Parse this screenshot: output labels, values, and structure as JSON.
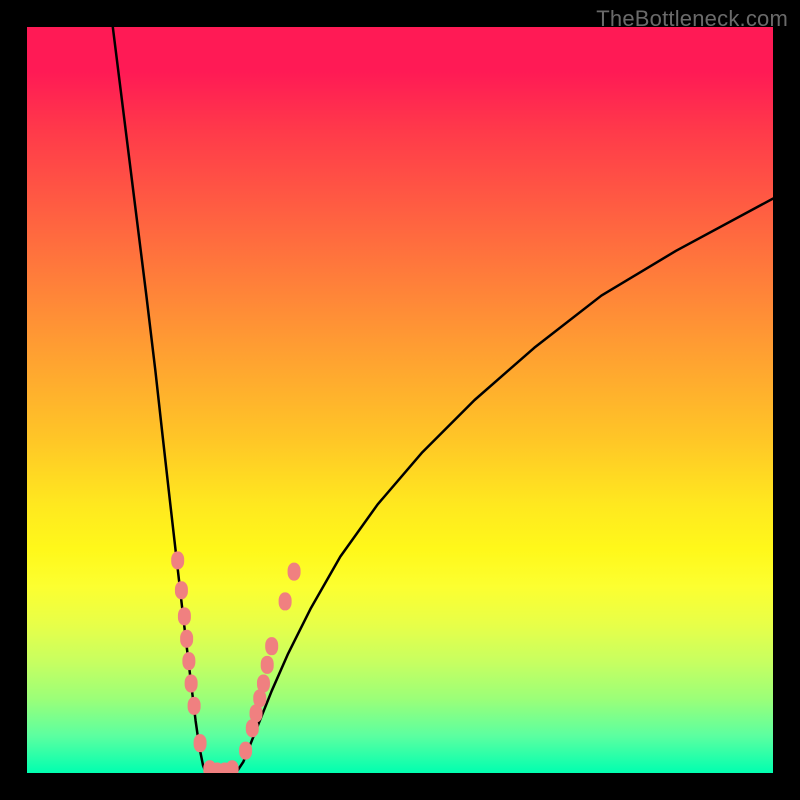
{
  "watermark": "TheBottleneck.com",
  "chart_data": {
    "type": "line",
    "title": "",
    "xlabel": "",
    "ylabel": "",
    "xlim": [
      0,
      100
    ],
    "ylim": [
      0,
      100
    ],
    "grid": false,
    "legend": false,
    "series": [
      {
        "name": "left-curve",
        "x": [
          11.5,
          13.0,
          14.5,
          16.0,
          17.2,
          18.2,
          19.1,
          19.9,
          20.7,
          21.4,
          22.0,
          22.6,
          23.1,
          23.6,
          24.0
        ],
        "y": [
          100,
          88,
          76,
          64,
          54,
          45,
          37,
          30,
          23,
          17,
          12,
          7,
          3.5,
          1,
          0
        ]
      },
      {
        "name": "valley-floor",
        "x": [
          24.0,
          25.0,
          26.0,
          27.0,
          28.0
        ],
        "y": [
          0,
          0,
          0,
          0,
          0
        ]
      },
      {
        "name": "right-curve",
        "x": [
          28.0,
          29.0,
          30.0,
          31.2,
          32.8,
          35.0,
          38.0,
          42.0,
          47.0,
          53.0,
          60.0,
          68.0,
          77.0,
          87.0,
          100.0
        ],
        "y": [
          0,
          1.5,
          4,
          7,
          11,
          16,
          22,
          29,
          36,
          43,
          50,
          57,
          64,
          70,
          77
        ]
      }
    ],
    "markers": {
      "name": "highlight-dots",
      "color": "#f08080",
      "points": [
        {
          "x": 20.2,
          "y": 28.5
        },
        {
          "x": 20.7,
          "y": 24.5
        },
        {
          "x": 21.1,
          "y": 21.0
        },
        {
          "x": 21.4,
          "y": 18.0
        },
        {
          "x": 21.7,
          "y": 15.0
        },
        {
          "x": 22.0,
          "y": 12.0
        },
        {
          "x": 22.4,
          "y": 9.0
        },
        {
          "x": 23.2,
          "y": 4.0
        },
        {
          "x": 24.5,
          "y": 0.5
        },
        {
          "x": 25.5,
          "y": 0.2
        },
        {
          "x": 26.5,
          "y": 0.2
        },
        {
          "x": 27.5,
          "y": 0.5
        },
        {
          "x": 29.3,
          "y": 3.0
        },
        {
          "x": 30.2,
          "y": 6.0
        },
        {
          "x": 30.7,
          "y": 8.0
        },
        {
          "x": 31.2,
          "y": 10.0
        },
        {
          "x": 31.7,
          "y": 12.0
        },
        {
          "x": 32.2,
          "y": 14.5
        },
        {
          "x": 32.8,
          "y": 17.0
        },
        {
          "x": 34.6,
          "y": 23.0
        },
        {
          "x": 35.8,
          "y": 27.0
        }
      ]
    },
    "background_gradient_stops": [
      {
        "pos": 0,
        "color": "#ff1a55"
      },
      {
        "pos": 40,
        "color": "#ff9a33"
      },
      {
        "pos": 70,
        "color": "#fff81a"
      },
      {
        "pos": 100,
        "color": "#00ffb0"
      }
    ]
  }
}
